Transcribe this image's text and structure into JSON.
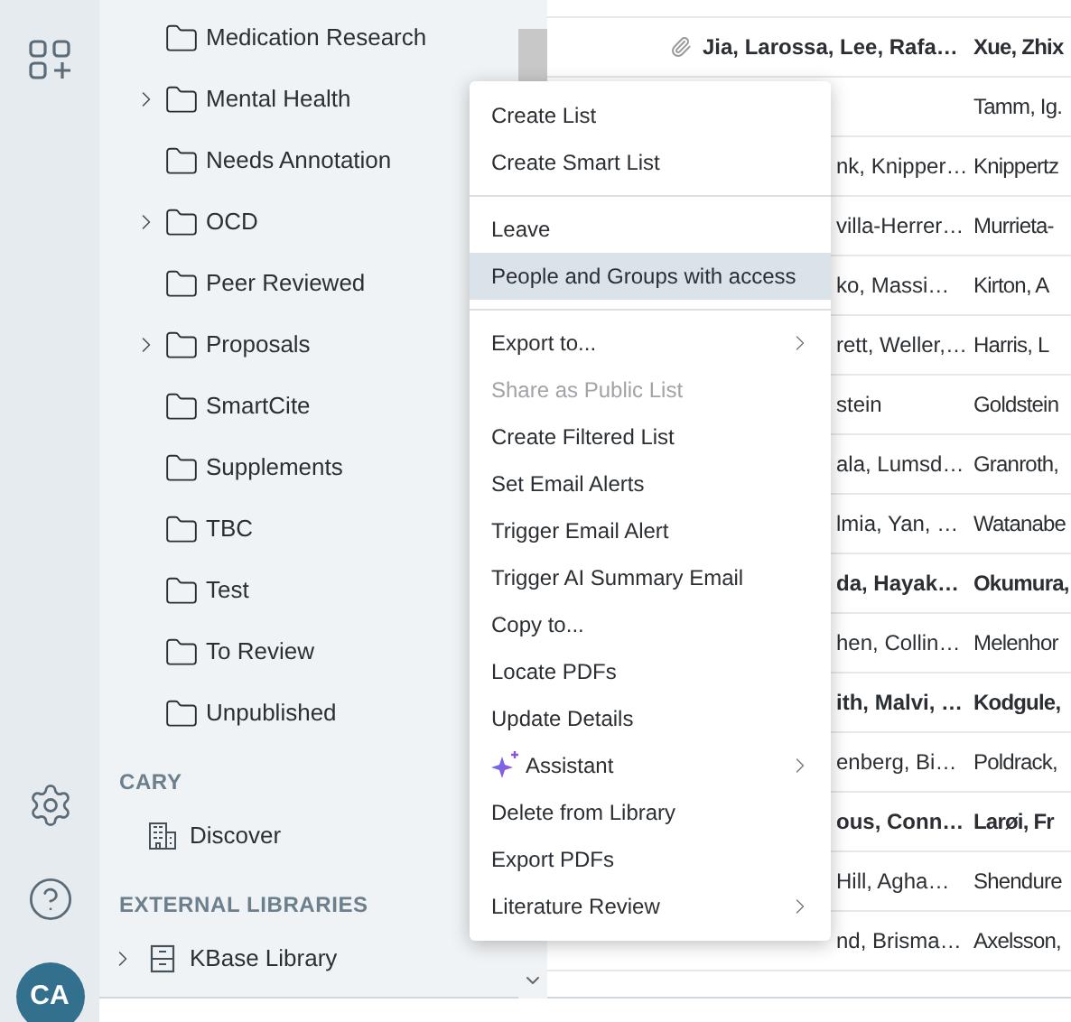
{
  "rail": {
    "avatar": "CA"
  },
  "sidebar": {
    "folders": [
      {
        "label": "Medication Research",
        "expandable": false
      },
      {
        "label": "Mental Health",
        "expandable": true
      },
      {
        "label": "Needs Annotation",
        "expandable": false
      },
      {
        "label": "OCD",
        "expandable": true
      },
      {
        "label": "Peer Reviewed",
        "expandable": false
      },
      {
        "label": "Proposals",
        "expandable": true
      },
      {
        "label": "SmartCite",
        "expandable": false
      },
      {
        "label": "Supplements",
        "expandable": false
      },
      {
        "label": "TBC",
        "expandable": false
      },
      {
        "label": "Test",
        "expandable": false
      },
      {
        "label": "To Review",
        "expandable": false
      },
      {
        "label": "Unpublished",
        "expandable": false
      }
    ],
    "sections": [
      {
        "title": "CARY",
        "items": [
          {
            "label": "Discover",
            "kind": "building",
            "expandable": false
          }
        ]
      },
      {
        "title": "EXTERNAL LIBRARIES",
        "items": [
          {
            "label": "KBase Library",
            "kind": "cabinet",
            "expandable": true
          }
        ]
      }
    ]
  },
  "table": {
    "rows": [
      {
        "kind": "full",
        "attachment": true,
        "bold": true,
        "column_1": "Jia, Larossa, Lee, Rafa…",
        "column_2": "Xue, Zhix"
      },
      {
        "kind": "covered",
        "bold": false,
        "column_1": "",
        "column_2": "Tamm, Ig."
      },
      {
        "kind": "covered",
        "bold": false,
        "column_1": "nk, Knipper…",
        "column_2": "Knippertz"
      },
      {
        "kind": "covered",
        "bold": false,
        "column_1": "villa-Herrer…",
        "column_2": "Murrieta-"
      },
      {
        "kind": "covered",
        "bold": false,
        "column_1": "ko, Massi…",
        "column_2": "Kirton, A"
      },
      {
        "kind": "covered",
        "bold": false,
        "column_1": "rett, Weller,…",
        "column_2": "Harris, L"
      },
      {
        "kind": "covered",
        "bold": false,
        "column_1": "stein",
        "column_2": "Goldstein"
      },
      {
        "kind": "covered",
        "bold": false,
        "column_1": "ala, Lumsd…",
        "column_2": "Granroth,"
      },
      {
        "kind": "covered",
        "bold": false,
        "column_1": "lmia, Yan, …",
        "column_2": "Watanabe"
      },
      {
        "kind": "covered",
        "bold": true,
        "column_1": "da, Hayak…",
        "column_2": "Okumura,"
      },
      {
        "kind": "covered",
        "bold": false,
        "column_1": "hen, Collin…",
        "column_2": "Melenhor"
      },
      {
        "kind": "covered",
        "bold": true,
        "column_1": "ith, Malvi, …",
        "column_2": "Kodgule,"
      },
      {
        "kind": "covered",
        "bold": false,
        "column_1": "enberg, Bi…",
        "column_2": "Poldrack,"
      },
      {
        "kind": "covered",
        "bold": true,
        "column_1": "ous, Conn…",
        "column_2": "Larøi, Fr"
      },
      {
        "kind": "covered",
        "bold": false,
        "column_1": "Hill, Agha…",
        "column_2": "Shendure"
      },
      {
        "kind": "covered",
        "bold": false,
        "column_1": "nd, Brisma…",
        "column_2": "Axelsson,"
      }
    ]
  },
  "context_menu": {
    "groups": [
      [
        {
          "label": "Create List",
          "disabled": false,
          "selected": false,
          "submenu": false,
          "kind": "plain"
        },
        {
          "label": "Create Smart List",
          "disabled": false,
          "selected": false,
          "submenu": false,
          "kind": "plain"
        }
      ],
      [
        {
          "label": "Leave",
          "disabled": false,
          "selected": false,
          "submenu": false,
          "kind": "plain"
        },
        {
          "label": "People and Groups with access",
          "disabled": false,
          "selected": true,
          "submenu": false,
          "kind": "plain"
        }
      ],
      [
        {
          "label": "Export to...",
          "disabled": false,
          "selected": false,
          "submenu": true,
          "kind": "plain"
        },
        {
          "label": "Share as Public List",
          "disabled": true,
          "selected": false,
          "submenu": false,
          "kind": "plain"
        },
        {
          "label": "Create Filtered List",
          "disabled": false,
          "selected": false,
          "submenu": false,
          "kind": "plain"
        },
        {
          "label": "Set Email Alerts",
          "disabled": false,
          "selected": false,
          "submenu": false,
          "kind": "plain"
        },
        {
          "label": "Trigger Email Alert",
          "disabled": false,
          "selected": false,
          "submenu": false,
          "kind": "plain"
        },
        {
          "label": "Trigger AI Summary Email",
          "disabled": false,
          "selected": false,
          "submenu": false,
          "kind": "plain"
        },
        {
          "label": "Copy to...",
          "disabled": false,
          "selected": false,
          "submenu": false,
          "kind": "plain"
        },
        {
          "label": "Locate PDFs",
          "disabled": false,
          "selected": false,
          "submenu": false,
          "kind": "plain"
        },
        {
          "label": "Update Details",
          "disabled": false,
          "selected": false,
          "submenu": false,
          "kind": "plain"
        },
        {
          "label": "Assistant",
          "disabled": false,
          "selected": false,
          "submenu": true,
          "kind": "sparkle"
        },
        {
          "label": "Delete from Library",
          "disabled": false,
          "selected": false,
          "submenu": false,
          "kind": "plain"
        },
        {
          "label": "Export PDFs",
          "disabled": false,
          "selected": false,
          "submenu": false,
          "kind": "plain"
        },
        {
          "label": "Literature Review",
          "disabled": false,
          "selected": false,
          "submenu": true,
          "kind": "plain"
        }
      ]
    ]
  }
}
